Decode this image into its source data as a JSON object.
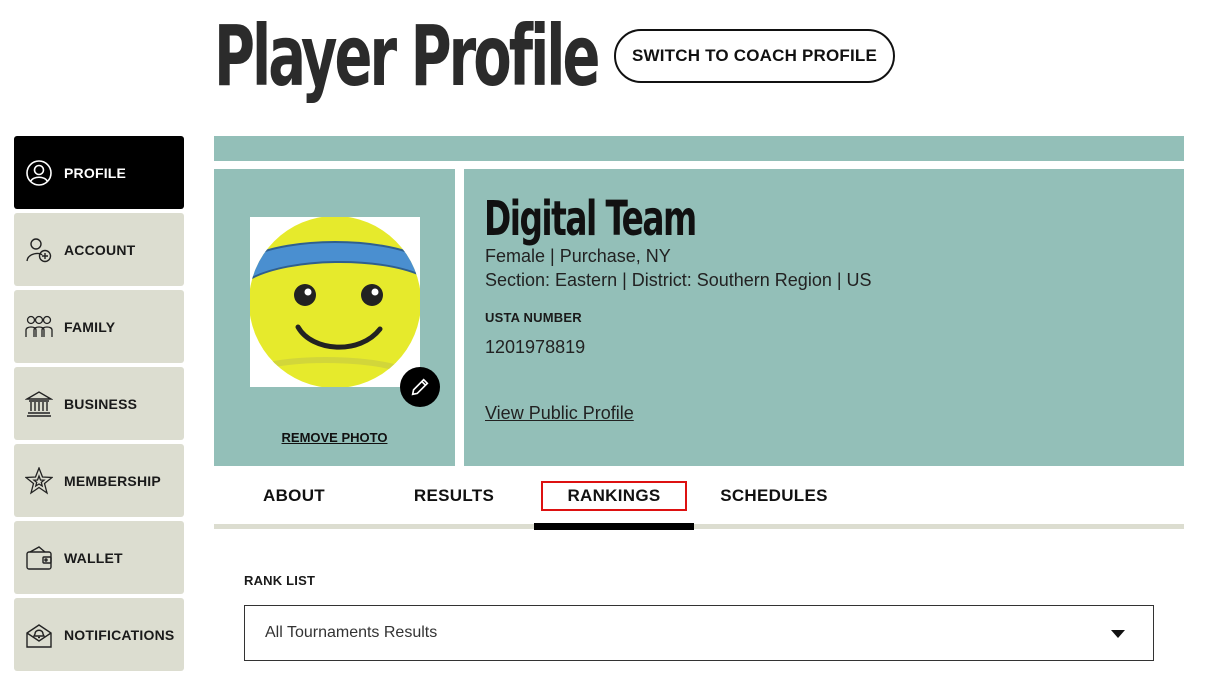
{
  "header": {
    "title": "Player Profile",
    "switch_button": "SWITCH TO COACH PROFILE"
  },
  "sidebar": {
    "items": [
      {
        "label": "PROFILE",
        "icon": "user-circle-icon",
        "active": true
      },
      {
        "label": "ACCOUNT",
        "icon": "user-add-icon",
        "active": false
      },
      {
        "label": "FAMILY",
        "icon": "family-icon",
        "active": false
      },
      {
        "label": "BUSINESS",
        "icon": "bank-icon",
        "active": false
      },
      {
        "label": "MEMBERSHIP",
        "icon": "star-badge-icon",
        "active": false
      },
      {
        "label": "WALLET",
        "icon": "wallet-icon",
        "active": false
      },
      {
        "label": "NOTIFICATIONS",
        "icon": "envelope-bell-icon",
        "active": false
      }
    ]
  },
  "profile": {
    "remove_photo": "REMOVE PHOTO",
    "name": "Digital Team",
    "gender_location": "Female | Purchase, NY",
    "section_line": "Section: Eastern | District: Southern Region | US",
    "usta_label": "USTA NUMBER",
    "usta_number": "1201978819",
    "public_profile_link": "View Public Profile"
  },
  "tabs": [
    {
      "label": "ABOUT",
      "active": false
    },
    {
      "label": "RESULTS",
      "active": false
    },
    {
      "label": "RANKINGS",
      "active": true
    },
    {
      "label": "SCHEDULES",
      "active": false
    }
  ],
  "rank_list": {
    "label": "RANK LIST",
    "selected": "All Tournaments Results"
  },
  "colors": {
    "teal_panel": "#93bfb8",
    "sidebar_bg": "#dcddd0",
    "active_bg": "#000000",
    "tab_highlight": "#dd1111",
    "avatar_ball": "#e6ea2c",
    "avatar_band": "#4a8fd0"
  }
}
